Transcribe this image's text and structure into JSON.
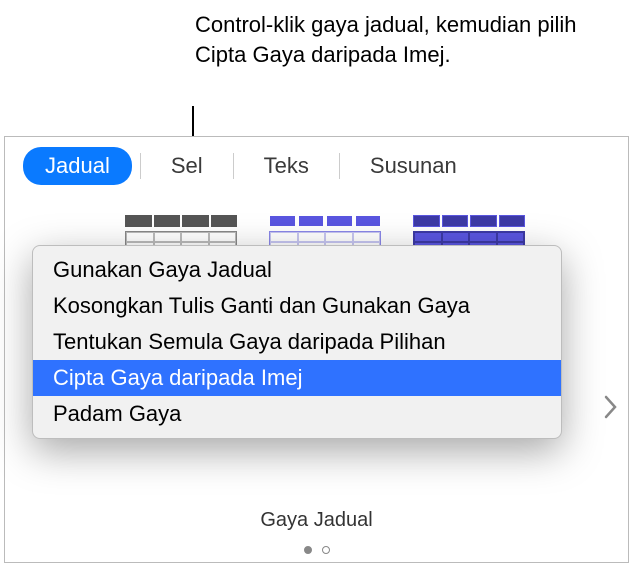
{
  "callout": "Control-klik gaya jadual, kemudian pilih Cipta Gaya daripada Imej.",
  "tabs": {
    "jadual": "Jadual",
    "sel": "Sel",
    "teks": "Teks",
    "susunan": "Susunan"
  },
  "menu": {
    "items": [
      "Gunakan Gaya Jadual",
      "Kosongkan Tulis Ganti dan Gunakan Gaya",
      "Tentukan Semula Gaya daripada Pilihan",
      "Cipta Gaya daripada Imej",
      "Padam Gaya"
    ]
  },
  "footer": {
    "style_label": "Gaya Jadual"
  }
}
